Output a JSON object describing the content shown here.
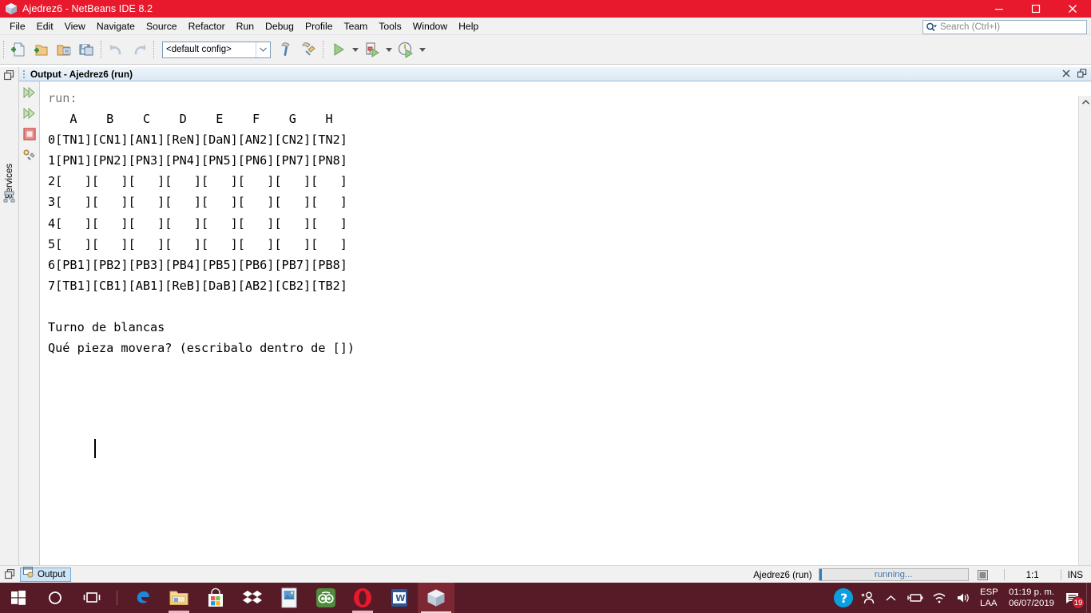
{
  "window": {
    "title": "Ajedrez6 - NetBeans IDE 8.2",
    "icon": "netbeans-cube-icon",
    "controls": {
      "minimize": "minimize-icon",
      "maximize": "maximize-icon",
      "close": "close-icon"
    },
    "titlebar_color": "#e8192c"
  },
  "menubar": {
    "items": [
      {
        "label": "File"
      },
      {
        "label": "Edit"
      },
      {
        "label": "View"
      },
      {
        "label": "Navigate"
      },
      {
        "label": "Source"
      },
      {
        "label": "Refactor"
      },
      {
        "label": "Run"
      },
      {
        "label": "Debug"
      },
      {
        "label": "Profile"
      },
      {
        "label": "Team"
      },
      {
        "label": "Tools"
      },
      {
        "label": "Window"
      },
      {
        "label": "Help"
      }
    ]
  },
  "search": {
    "placeholder": "Search (Ctrl+I)",
    "value": "",
    "icon": "search-icon"
  },
  "toolbar": {
    "buttons": [
      {
        "name": "new-file-button",
        "icon": "new-file-icon"
      },
      {
        "name": "new-project-button",
        "icon": "new-project-icon"
      },
      {
        "name": "open-project-button",
        "icon": "open-project-icon"
      },
      {
        "name": "save-all-button",
        "icon": "save-all-icon"
      },
      {
        "name": "undo-button",
        "icon": "undo-icon"
      },
      {
        "name": "redo-button",
        "icon": "redo-icon"
      }
    ],
    "config_combo": {
      "value": "<default config>",
      "caret": "chevron-down-icon"
    },
    "build_buttons": [
      {
        "name": "build-project-button",
        "icon": "hammer-icon"
      },
      {
        "name": "clean-build-button",
        "icon": "clean-build-icon"
      }
    ],
    "run_buttons": [
      {
        "name": "run-project-button",
        "icon": "run-icon"
      },
      {
        "name": "debug-project-button",
        "icon": "debug-icon"
      },
      {
        "name": "profile-project-button",
        "icon": "profile-icon"
      }
    ]
  },
  "left_dock": {
    "minimize_icon": "minimize-window-icon",
    "services_tab": {
      "label": "Services",
      "icon": "services-icon"
    }
  },
  "output_window": {
    "tab_title": "Output - Ajedrez6 (run)",
    "grip_icon": "drag-grip-icon",
    "close_icon": "close-icon",
    "maximize_icon": "maximize-window-icon",
    "side_tools": [
      {
        "name": "rerun-button",
        "icon": "rerun-green-arrows-icon"
      },
      {
        "name": "rerun-with-different-params-button",
        "icon": "rerun-green-arrows-icon"
      },
      {
        "name": "stop-process-button",
        "icon": "stop-red-square-icon"
      },
      {
        "name": "settings-button",
        "icon": "gear-settings-icon"
      }
    ],
    "scrollbar": {
      "up_icon": "chevron-up-icon",
      "down_icon": "chevron-down-icon"
    },
    "console": {
      "run_label": "run:",
      "board": {
        "column_headers": [
          "A",
          "B",
          "C",
          "D",
          "E",
          "F",
          "G",
          "H"
        ],
        "row_labels": [
          "0",
          "1",
          "2",
          "3",
          "4",
          "5",
          "6",
          "7"
        ],
        "rows": [
          [
            "TN1",
            "CN1",
            "AN1",
            "ReN",
            "DaN",
            "AN2",
            "CN2",
            "TN2"
          ],
          [
            "PN1",
            "PN2",
            "PN3",
            "PN4",
            "PN5",
            "PN6",
            "PN7",
            "PN8"
          ],
          [
            "   ",
            "   ",
            "   ",
            "   ",
            "   ",
            "   ",
            "   ",
            "   "
          ],
          [
            "   ",
            "   ",
            "   ",
            "   ",
            "   ",
            "   ",
            "   ",
            "   "
          ],
          [
            "   ",
            "   ",
            "   ",
            "   ",
            "   ",
            "   ",
            "   ",
            "   "
          ],
          [
            "   ",
            "   ",
            "   ",
            "   ",
            "   ",
            "   ",
            "   ",
            "   "
          ],
          [
            "PB1",
            "PB2",
            "PB3",
            "PB4",
            "PB5",
            "PB6",
            "PB7",
            "PB8"
          ],
          [
            "TB1",
            "CB1",
            "AB1",
            "ReB",
            "DaB",
            "AB2",
            "CB2",
            "TB2"
          ]
        ]
      },
      "messages": [
        "Turno de blancas",
        "Qué pieza movera? (escribalo dentro de [])"
      ],
      "input_value": "",
      "caret_visible": true
    }
  },
  "statusbar": {
    "minimize_icon": "minimize-window-icon",
    "output_chip": {
      "label": "Output",
      "icon": "output-window-icon"
    },
    "project_status": "Ajedrez6 (run)",
    "progress_label": "running...",
    "stop_icon": "stop-process-icon",
    "cursor_position": "1:1",
    "insert_mode": "INS"
  },
  "taskbar": {
    "background": "#561b26",
    "items": [
      {
        "name": "start-button",
        "icon": "windows-logo-icon"
      },
      {
        "name": "cortana-search-button",
        "icon": "cortana-circle-icon"
      },
      {
        "name": "task-view-button",
        "icon": "task-view-icon"
      },
      {
        "name": "edge-button",
        "icon": "edge-icon"
      },
      {
        "name": "file-explorer-button",
        "icon": "file-explorer-icon"
      },
      {
        "name": "microsoft-store-button",
        "icon": "microsoft-store-icon"
      },
      {
        "name": "dropbox-button",
        "icon": "dropbox-icon"
      },
      {
        "name": "photos-button",
        "icon": "photos-icon"
      },
      {
        "name": "tripadvisor-button",
        "icon": "tripadvisor-owl-icon"
      },
      {
        "name": "opera-button",
        "icon": "opera-icon"
      },
      {
        "name": "word-button",
        "icon": "word-icon"
      },
      {
        "name": "netbeans-button",
        "icon": "netbeans-cube-icon"
      }
    ],
    "tray": {
      "help_icon": "help-circle-icon",
      "people_icon": "people-icon",
      "show_hidden_icon": "chevron-up-icon",
      "battery_icon": "battery-plug-icon",
      "wifi_icon": "wifi-icon",
      "volume_icon": "speaker-icon",
      "language_top": "ESP",
      "language_bottom": "LAA",
      "time": "01:19 p. m.",
      "date": "06/07/2019",
      "notification_icon": "notification-icon",
      "notification_count": "19"
    }
  }
}
